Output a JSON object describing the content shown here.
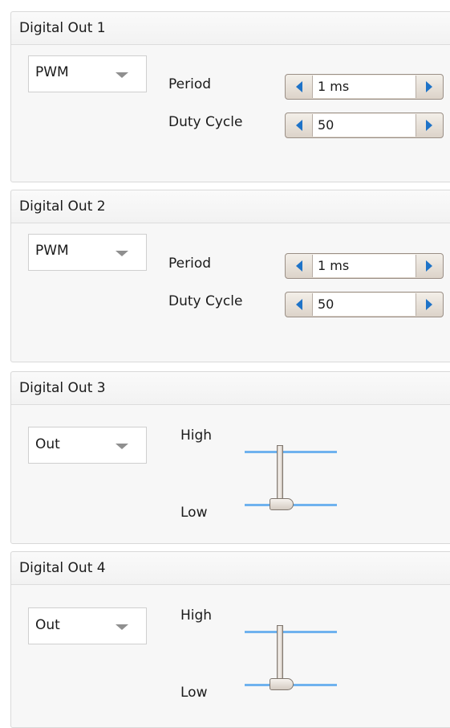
{
  "panels": [
    {
      "title": "Digital Out 1",
      "mode": "PWM",
      "period_label": "Period",
      "period_value": "1 ms",
      "duty_label": "Duty Cycle",
      "duty_value": "50"
    },
    {
      "title": "Digital Out 2",
      "mode": "PWM",
      "period_label": "Period",
      "period_value": "1 ms",
      "duty_label": "Duty Cycle",
      "duty_value": "50"
    },
    {
      "title": "Digital Out 3",
      "mode": "Out",
      "high_label": "High",
      "low_label": "Low",
      "state": "Low"
    },
    {
      "title": "Digital Out 4",
      "mode": "Out",
      "high_label": "High",
      "low_label": "Low",
      "state": "Low"
    }
  ],
  "colors": {
    "accent": "#1e73c8",
    "switch_line": "#6fb2ee"
  },
  "icons": {
    "dropdown": "chevron-down-icon",
    "decrement": "arrow-left-icon",
    "increment": "arrow-right-icon"
  }
}
